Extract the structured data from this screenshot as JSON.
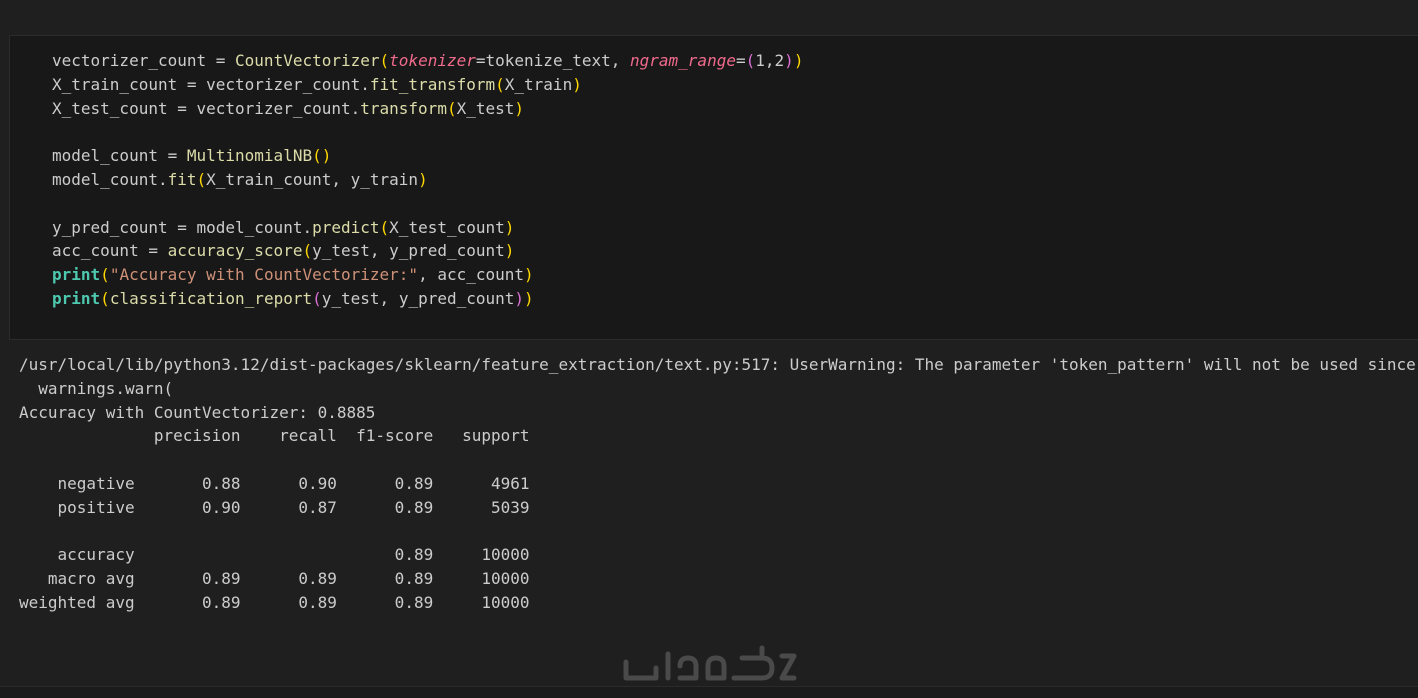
{
  "code_cell": {
    "lines": [
      [
        {
          "t": "vectorizer_count ",
          "c": "var"
        },
        {
          "t": "= ",
          "c": "var"
        },
        {
          "t": "CountVectorizer",
          "c": "func"
        },
        {
          "t": "(",
          "c": "paren1"
        },
        {
          "t": "tokenizer",
          "c": "param"
        },
        {
          "t": "=tokenize_text, ",
          "c": "var"
        },
        {
          "t": "ngram_range",
          "c": "param"
        },
        {
          "t": "=",
          "c": "var"
        },
        {
          "t": "(",
          "c": "paren2"
        },
        {
          "t": "1",
          "c": "var"
        },
        {
          "t": ",",
          "c": "var"
        },
        {
          "t": "2",
          "c": "var"
        },
        {
          "t": ")",
          "c": "paren2"
        },
        {
          "t": ")",
          "c": "paren1"
        }
      ],
      [
        {
          "t": "X_train_count = vectorizer_count.",
          "c": "var"
        },
        {
          "t": "fit_transform",
          "c": "func"
        },
        {
          "t": "(",
          "c": "paren1"
        },
        {
          "t": "X_train",
          "c": "var"
        },
        {
          "t": ")",
          "c": "paren1"
        }
      ],
      [
        {
          "t": "X_test_count = vectorizer_count.",
          "c": "var"
        },
        {
          "t": "transform",
          "c": "func"
        },
        {
          "t": "(",
          "c": "paren1"
        },
        {
          "t": "X_test",
          "c": "var"
        },
        {
          "t": ")",
          "c": "paren1"
        }
      ],
      [],
      [
        {
          "t": "model_count = ",
          "c": "var"
        },
        {
          "t": "MultinomialNB",
          "c": "func"
        },
        {
          "t": "(",
          "c": "paren1"
        },
        {
          "t": ")",
          "c": "paren1"
        }
      ],
      [
        {
          "t": "model_count.",
          "c": "var"
        },
        {
          "t": "fit",
          "c": "func"
        },
        {
          "t": "(",
          "c": "paren1"
        },
        {
          "t": "X_train_count, y_train",
          "c": "var"
        },
        {
          "t": ")",
          "c": "paren1"
        }
      ],
      [],
      [
        {
          "t": "y_pred_count = model_count.",
          "c": "var"
        },
        {
          "t": "predict",
          "c": "func"
        },
        {
          "t": "(",
          "c": "paren1"
        },
        {
          "t": "X_test_count",
          "c": "var"
        },
        {
          "t": ")",
          "c": "paren1"
        }
      ],
      [
        {
          "t": "acc_count = ",
          "c": "var"
        },
        {
          "t": "accuracy_score",
          "c": "func"
        },
        {
          "t": "(",
          "c": "paren1"
        },
        {
          "t": "y_test, y_pred_count",
          "c": "var"
        },
        {
          "t": ")",
          "c": "paren1"
        }
      ],
      [
        {
          "t": "print",
          "c": "kw"
        },
        {
          "t": "(",
          "c": "paren1"
        },
        {
          "t": "\"Accuracy with CountVectorizer:\"",
          "c": "str"
        },
        {
          "t": ", acc_count",
          "c": "var"
        },
        {
          "t": ")",
          "c": "paren1"
        }
      ],
      [
        {
          "t": "print",
          "c": "kw"
        },
        {
          "t": "(",
          "c": "paren1"
        },
        {
          "t": "classification_report",
          "c": "func"
        },
        {
          "t": "(",
          "c": "paren2"
        },
        {
          "t": "y_test, y_pred_count",
          "c": "var"
        },
        {
          "t": ")",
          "c": "paren2"
        },
        {
          "t": ")",
          "c": "paren1"
        }
      ]
    ]
  },
  "output": {
    "lines": [
      "/usr/local/lib/python3.12/dist-packages/sklearn/feature_extraction/text.py:517: UserWarning: The parameter 'token_pattern' will not be used since",
      "  warnings.warn(",
      "Accuracy with CountVectorizer: 0.8885",
      "              precision    recall  f1-score   support",
      "",
      "    negative       0.88      0.90      0.89      4961",
      "    positive       0.90      0.87      0.89      5039",
      "",
      "    accuracy                           0.89     10000",
      "   macro avg       0.89      0.89      0.89     10000",
      "weighted avg       0.89      0.89      0.89     10000"
    ]
  },
  "watermark": {
    "text": "خمسات"
  },
  "colors": {
    "background": "#1f1f1f",
    "cell_background": "#181818",
    "text": "#cccccc",
    "function": "#dcdcaa",
    "keyword": "#4ec9b0",
    "parameter": "#f06a8c",
    "string": "#ce9178",
    "bracket_level1": "#ffd700",
    "bracket_level2": "#da70d6"
  }
}
